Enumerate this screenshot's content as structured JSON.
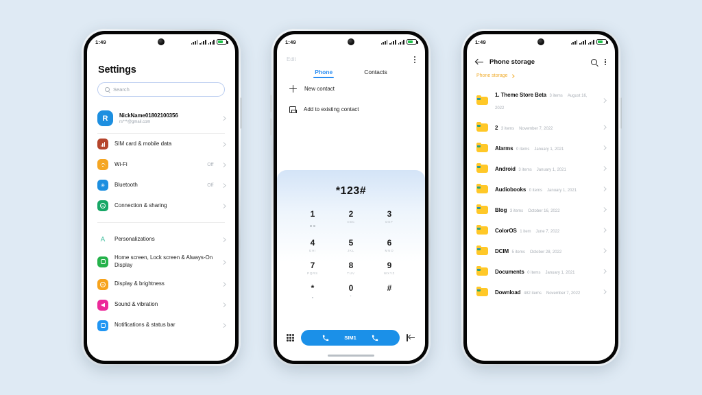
{
  "status_bar": {
    "time": "1:49"
  },
  "phone1": {
    "title": "Settings",
    "search_placeholder": "Search",
    "account": {
      "initial": "R",
      "name": "NickName01802100356",
      "email": "rs***@gmail.com"
    },
    "groups": [
      {
        "items": [
          {
            "label": "SIM card & mobile data",
            "value": "",
            "icon": "signal-icon",
            "color": "#b5442b"
          },
          {
            "label": "Wi-Fi",
            "value": "Off",
            "icon": "wifi-icon",
            "color": "#f5a623"
          },
          {
            "label": "Bluetooth",
            "value": "Off",
            "icon": "bluetooth-icon",
            "color": "#1d8fe0"
          },
          {
            "label": "Connection & sharing",
            "value": "",
            "icon": "connection-icon",
            "color": "#17a766"
          }
        ]
      },
      {
        "items": [
          {
            "label": "Personalizations",
            "value": "",
            "icon": "personalization-icon",
            "color": "#ffffff"
          },
          {
            "label": "Home screen, Lock screen & Always-On Display",
            "value": "",
            "icon": "home-screen-icon",
            "color": "#25b24b"
          },
          {
            "label": "Display & brightness",
            "value": "",
            "icon": "display-icon",
            "color": "#f7a31c"
          },
          {
            "label": "Sound & vibration",
            "value": "",
            "icon": "sound-icon",
            "color": "#ec2a9a"
          },
          {
            "label": "Notifications & status bar",
            "value": "",
            "icon": "notifications-icon",
            "color": "#2196f3"
          }
        ]
      }
    ]
  },
  "phone2": {
    "edit_label": "Edit",
    "tabs": [
      {
        "label": "Phone",
        "active": true
      },
      {
        "label": "Contacts",
        "active": false
      }
    ],
    "actions": [
      {
        "label": "New contact",
        "icon": "plus-icon"
      },
      {
        "label": "Add to existing contact",
        "icon": "save-contact-icon"
      }
    ],
    "dialed_number": "*123#",
    "keys": [
      {
        "num": "1",
        "letters": "",
        "sub": "voicemail"
      },
      {
        "num": "2",
        "letters": "ABC",
        "sub": ""
      },
      {
        "num": "3",
        "letters": "DEF",
        "sub": ""
      },
      {
        "num": "4",
        "letters": "GHI",
        "sub": ""
      },
      {
        "num": "5",
        "letters": "JKL",
        "sub": ""
      },
      {
        "num": "6",
        "letters": "MNO",
        "sub": ""
      },
      {
        "num": "7",
        "letters": "PQRS",
        "sub": ""
      },
      {
        "num": "8",
        "letters": "TUV",
        "sub": ""
      },
      {
        "num": "9",
        "letters": "WXYZ",
        "sub": ""
      },
      {
        "num": "*",
        "letters": "",
        "sub": "dot"
      },
      {
        "num": "0",
        "letters": "",
        "sub": "plus"
      },
      {
        "num": "#",
        "letters": "",
        "sub": ""
      }
    ],
    "call_button_label": "SIM1",
    "accent": "#1b90e8"
  },
  "phone3": {
    "title": "Phone storage",
    "breadcrumb": "Phone storage",
    "breadcrumb_color": "#f0ab2a",
    "folders": [
      {
        "name": "1. Theme Store Beta",
        "items": "3 items",
        "date": "August 16, 2022"
      },
      {
        "name": "2",
        "items": "3 items",
        "date": "November 7, 2022"
      },
      {
        "name": "Alarms",
        "items": "0 items",
        "date": "January 1, 2021"
      },
      {
        "name": "Android",
        "items": "3 items",
        "date": "January 1, 2021"
      },
      {
        "name": "Audiobooks",
        "items": "0 items",
        "date": "January 1, 2021"
      },
      {
        "name": "Blog",
        "items": "3 items",
        "date": "October 16, 2022"
      },
      {
        "name": "ColorOS",
        "items": "1 item",
        "date": "June 7, 2022"
      },
      {
        "name": "DCIM",
        "items": "5 items",
        "date": "October 28, 2022"
      },
      {
        "name": "Documents",
        "items": "0 items",
        "date": "January 1, 2021"
      },
      {
        "name": "Download",
        "items": "482 items",
        "date": "November 7, 2022"
      }
    ]
  }
}
